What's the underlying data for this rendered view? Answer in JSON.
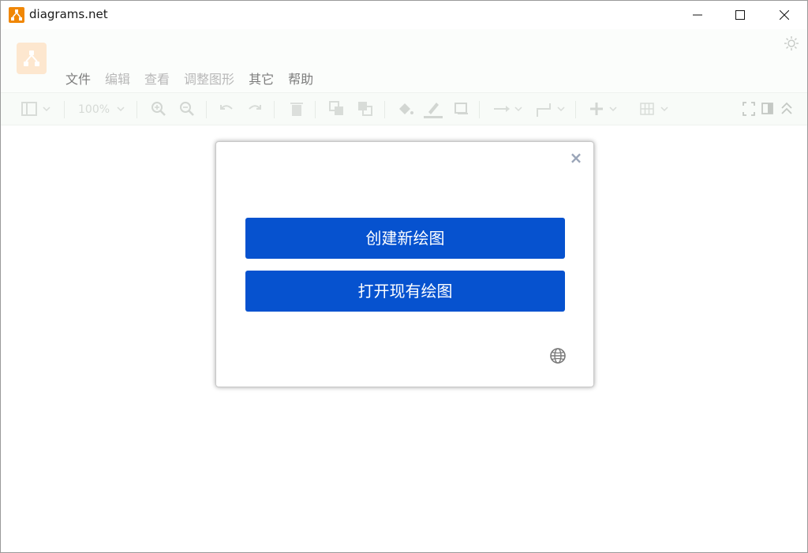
{
  "window": {
    "title": "diagrams.net"
  },
  "menu": {
    "items": [
      {
        "label": "文件"
      },
      {
        "label": "编辑"
      },
      {
        "label": "查看"
      },
      {
        "label": "调整图形"
      },
      {
        "label": "其它"
      },
      {
        "label": "帮助"
      }
    ]
  },
  "toolbar": {
    "zoom": "100%"
  },
  "dialog": {
    "close_label": "×",
    "create_label": "创建新绘图",
    "open_label": "打开现有绘图"
  },
  "colors": {
    "brand_orange": "#f08705",
    "primary_button": "#0652cf"
  },
  "icons": {
    "app": "drawio-logo-icon",
    "theme": "sun-icon",
    "language": "globe-icon"
  }
}
